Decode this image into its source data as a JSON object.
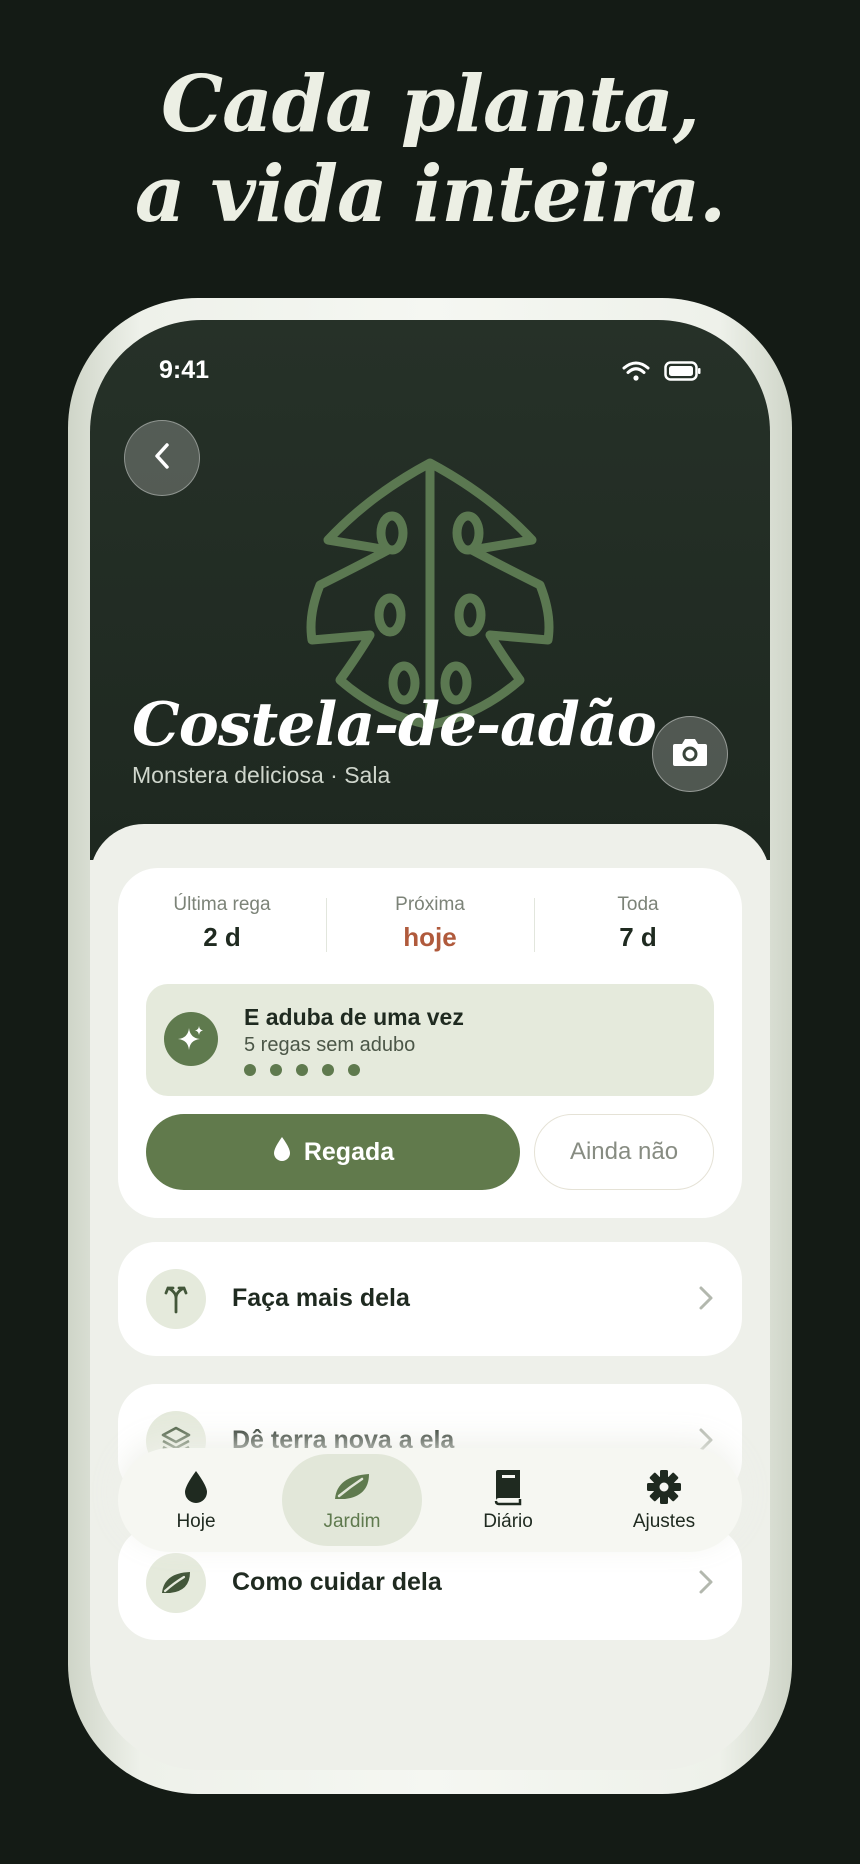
{
  "headline": {
    "line1": "Cada planta,",
    "line2": "a vida inteira."
  },
  "status_bar": {
    "time": "9:41"
  },
  "plant": {
    "name": "Costela-de-adão",
    "subtitle": "Monstera deliciosa · Sala"
  },
  "stats": [
    {
      "label": "Última rega",
      "value": "2 d"
    },
    {
      "label": "Próxima",
      "value": "hoje"
    },
    {
      "label": "Toda",
      "value": "7 d"
    }
  ],
  "tip": {
    "title": "E aduba de uma vez",
    "subtitle": "5 regas sem adubo",
    "dots": 5
  },
  "actions": {
    "primary": "Regada",
    "secondary": "Ainda não"
  },
  "rows": [
    {
      "label": "Faça mais dela",
      "icon": "sprout-fork-icon"
    },
    {
      "label": "Dê terra nova a ela",
      "icon": "layers-icon"
    },
    {
      "label": "Como cuidar dela",
      "icon": "leaf-icon"
    }
  ],
  "tabs": [
    {
      "label": "Hoje",
      "icon": "drop-icon"
    },
    {
      "label": "Jardim",
      "icon": "leaf-icon",
      "active": true
    },
    {
      "label": "Diário",
      "icon": "book-icon"
    },
    {
      "label": "Ajustes",
      "icon": "gear-icon"
    }
  ],
  "colors": {
    "background": "#141b15",
    "accent_green": "#617a4c",
    "accent_rust": "#b05a3c",
    "hero": "#263128"
  }
}
